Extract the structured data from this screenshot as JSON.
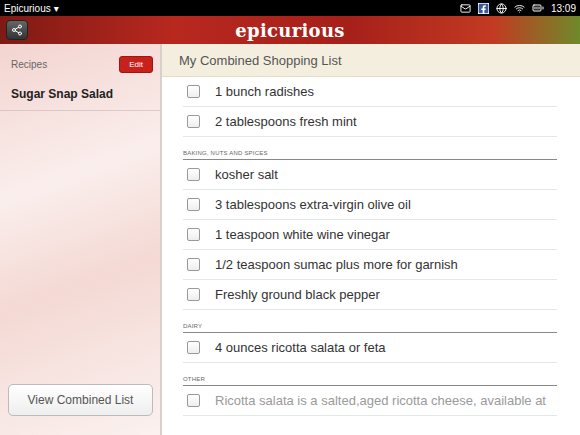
{
  "status_bar": {
    "app": "Epicurious",
    "menu_arrow": "▾",
    "time": "13:09"
  },
  "header": {
    "logo": "epicurious"
  },
  "sidebar": {
    "label": "Recipes",
    "edit_button": "Edit",
    "items": [
      {
        "label": "Sugar Snap Salad"
      }
    ],
    "button": "View Combined List"
  },
  "list": {
    "title": "My Combined Shopping List",
    "rows": [
      {
        "kind": "item",
        "text": "1 bunch radishes",
        "checked": false
      },
      {
        "kind": "item",
        "text": "2 tablespoons fresh mint",
        "checked": false
      },
      {
        "kind": "heading",
        "text": "BAKING, NUTS AND SPICES"
      },
      {
        "kind": "item",
        "text": "kosher salt",
        "checked": false
      },
      {
        "kind": "item",
        "text": "3 tablespoons extra-virgin olive oil",
        "checked": false
      },
      {
        "kind": "item",
        "text": "1 teaspoon white wine vinegar",
        "checked": false
      },
      {
        "kind": "item",
        "text": "1/2 teaspoon sumac plus more for garnish",
        "checked": false
      },
      {
        "kind": "item",
        "text": "Freshly ground black pepper",
        "checked": false
      },
      {
        "kind": "heading",
        "text": "DAIRY"
      },
      {
        "kind": "item",
        "text": "4 ounces ricotta salata or feta",
        "checked": false
      },
      {
        "kind": "heading",
        "text": "OTHER"
      },
      {
        "kind": "note",
        "text": "Ricotta salata is a salted,aged ricotta cheese, available at",
        "checked": false
      }
    ]
  }
}
